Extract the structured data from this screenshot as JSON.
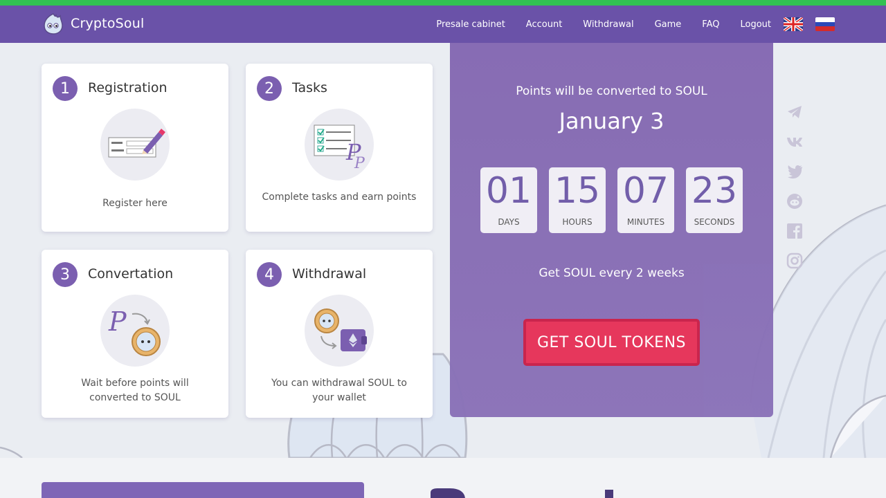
{
  "brand": {
    "name": "CryptoSoul"
  },
  "nav": {
    "items": [
      "Presale cabinet",
      "Account",
      "Withdrawal",
      "Game",
      "FAQ",
      "Logout"
    ],
    "flags": [
      "uk-flag-icon",
      "ru-flag-icon"
    ]
  },
  "steps": [
    {
      "num": "1",
      "title": "Registration",
      "desc": "Register here"
    },
    {
      "num": "2",
      "title": "Tasks",
      "desc": "Complete tasks and earn points"
    },
    {
      "num": "3",
      "title": "Convertation",
      "desc": "Wait before points will converted to SOUL"
    },
    {
      "num": "4",
      "title": "Withdrawal",
      "desc": "You can withdrawal SOUL to your wallet"
    }
  ],
  "promo": {
    "subtitle": "Points will be converted to SOUL",
    "date": "January 3",
    "timer": [
      {
        "value": "01",
        "label": "DAYS"
      },
      {
        "value": "15",
        "label": "HOURS"
      },
      {
        "value": "07",
        "label": "MINUTES"
      },
      {
        "value": "23",
        "label": "SECONDS"
      }
    ],
    "note": "Get SOUL every 2 weeks",
    "cta": "GET SOUL TOKENS"
  },
  "social": [
    "telegram-icon",
    "vk-icon",
    "twitter-icon",
    "reddit-icon",
    "facebook-icon",
    "instagram-icon"
  ],
  "colors": {
    "header": "#6a52a8",
    "accent": "#7b5fb0",
    "cta": "#e63258",
    "topline": "#32c152"
  }
}
